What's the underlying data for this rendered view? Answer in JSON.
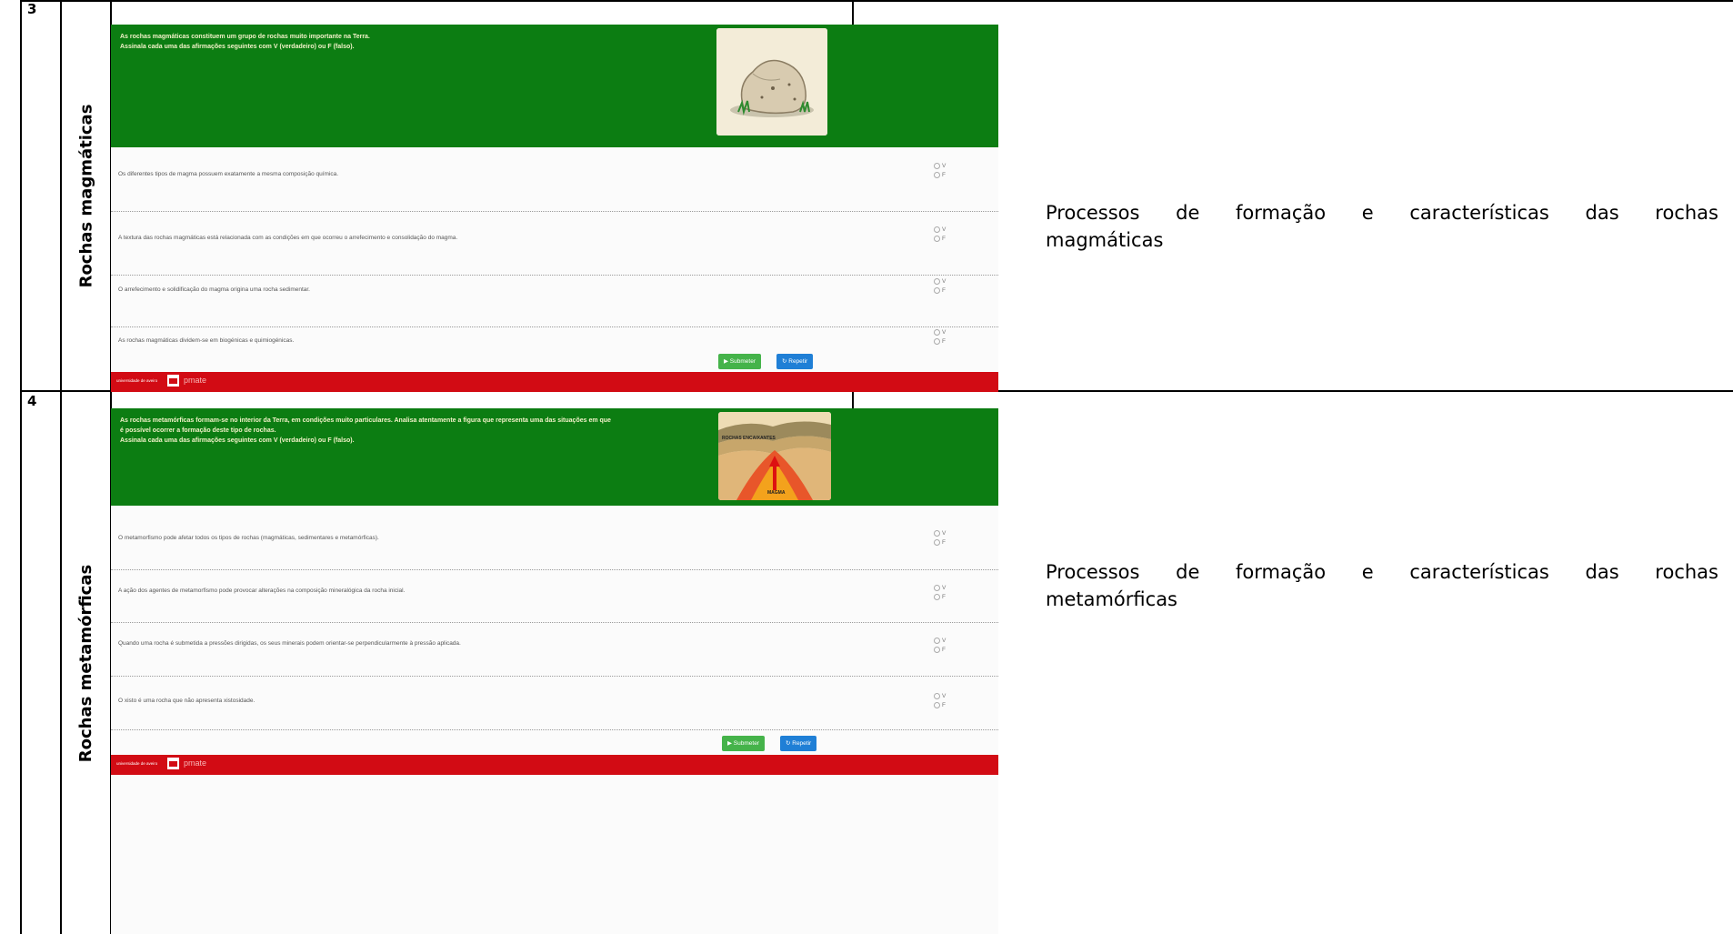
{
  "rows": [
    {
      "number": "3",
      "topic": "Rochas magmáticas",
      "description_line1": "Processos de formação e características das rochas",
      "description_line2": "magmáticas",
      "activity": {
        "intro": [
          "As rochas magmáticas constituem um grupo de rochas muito importante na Terra.",
          "Assinala cada uma das afirmações seguintes com V (verdadeiro) ou F (falso)."
        ],
        "image_icon": "rock-illustration",
        "questions": [
          "Os diferentes tipos de magma possuem exatamente a mesma composição química.",
          "A textura das rochas magmáticas está relacionada com as condições em que ocorreu o arrefecimento e consolidação do magma.",
          "O arrefecimento e solidificação do magma origina uma rocha sedimentar.",
          "As rochas magmáticas dividem-se em biogénicas e quimiogénicas."
        ],
        "option_v": "V",
        "option_f": "F",
        "submit_label": "▶ Submeter",
        "repeat_label": "↻ Repetir",
        "footer_left": "universidade de aveiro",
        "footer_brand": "pmate"
      }
    },
    {
      "number": "4",
      "topic": "Rochas metamórficas",
      "description_line1": "Processos de formação e características das rochas",
      "description_line2": "metamórficas",
      "activity": {
        "intro": [
          "As rochas metamórficas formam-se no interior da Terra, em condições muito particulares. Analisa atentamente a figura que representa uma das situações em que",
          "é possível ocorrer a formação deste tipo de rochas.",
          "Assinala cada uma das afirmações seguintes com V (verdadeiro) ou F (falso)."
        ],
        "image_icon": "magma-cross-section-illustration",
        "image_labels": [
          "ROCHAS ENCAIXANTES",
          "MAGMA"
        ],
        "questions": [
          "O metamorfismo pode afetar todos os tipos de rochas (magmáticas, sedimentares e metamórficas).",
          "A ação dos agentes de metamorfismo pode provocar alterações na composição mineralógica da rocha inicial.",
          "Quando uma rocha é submetida a pressões dirigidas, os seus minerais podem orientar-se perpendicularmente à pressão aplicada.",
          "O xisto é uma rocha que não apresenta xistosidade."
        ],
        "option_v": "V",
        "option_f": "F",
        "submit_label": "▶ Submeter",
        "repeat_label": "↻ Repetir",
        "footer_left": "universidade de aveiro",
        "footer_brand": "pmate"
      }
    }
  ],
  "colors": {
    "header_green": "#0c7d12",
    "footer_red": "#d20b14",
    "submit_green": "#45b34a",
    "repeat_blue": "#1f7fd6"
  }
}
